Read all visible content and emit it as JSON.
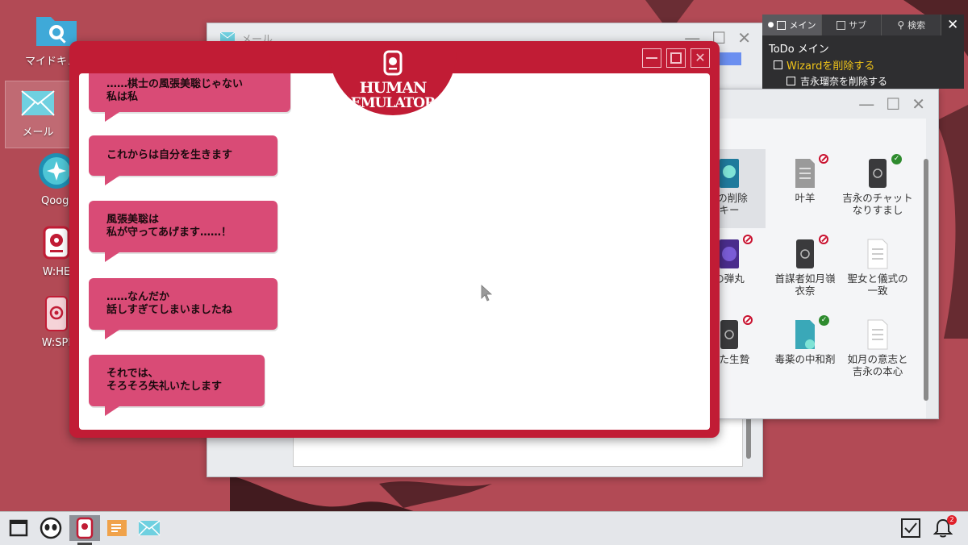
{
  "desktop": {
    "icons": [
      {
        "label": "マイドキュメ",
        "icon": "folder-search-icon"
      },
      {
        "label": "メール",
        "icon": "mail-icon"
      },
      {
        "label": "Qoogl",
        "icon": "browser-icon"
      },
      {
        "label": "W:HE",
        "icon": "human-emulator-icon"
      },
      {
        "label": "W:SPI",
        "icon": "spy-phone-icon"
      }
    ]
  },
  "mail_window": {
    "title": "メール"
  },
  "todo": {
    "tabs": [
      {
        "label": "メイン",
        "active": true
      },
      {
        "label": "サブ",
        "active": false
      },
      {
        "label": "検索",
        "active": false
      }
    ],
    "title": "ToDo メイン",
    "items": [
      {
        "text": "Wizardを削除する",
        "level": 0,
        "highlight": true
      },
      {
        "text": "吉永瑠奈を削除する",
        "level": 1,
        "highlight": false
      }
    ]
  },
  "files": {
    "items": [
      {
        "label": "Eの削除\nキー",
        "icon": "app-key-icon",
        "status": "none"
      },
      {
        "label": "叶羊",
        "icon": "document-gray-icon",
        "status": "blocked"
      },
      {
        "label": "吉永のチャット\nなりすまし",
        "icon": "phone-app-icon",
        "status": "ok"
      },
      {
        "label": "の弾丸",
        "icon": "app-purple-icon",
        "status": "blocked"
      },
      {
        "label": "首謀者如月嶺\n衣奈",
        "icon": "phone-app-icon",
        "status": "blocked"
      },
      {
        "label": "聖女と儀式の\n一致",
        "icon": "document-icon",
        "status": "none"
      },
      {
        "label": "れた生贄",
        "icon": "phone-app-icon",
        "status": "blocked"
      },
      {
        "label": "毒薬の中和剤",
        "icon": "document-teal-icon",
        "status": "ok"
      },
      {
        "label": "如月の意志と\n吉永の本心",
        "icon": "document-icon",
        "status": "none"
      }
    ]
  },
  "chat": {
    "logo_line1": "HUMAN",
    "logo_line2": "EMULATOR",
    "messages": [
      "……棋士の風張美聡じゃない\n私は私",
      "これからは自分を生きます",
      "風張美聡は\n私が守ってあげます……！",
      "……なんだか\n話しすぎてしまいましたね",
      "それでは、\nそろそろ失礼いたします"
    ]
  },
  "taskbar": {
    "notification_count": "2"
  },
  "colors": {
    "wallpaper": "#b24a55",
    "chat_frame": "#c11c35",
    "bubble": "#d94b76",
    "todo_highlight": "#f0c419"
  }
}
